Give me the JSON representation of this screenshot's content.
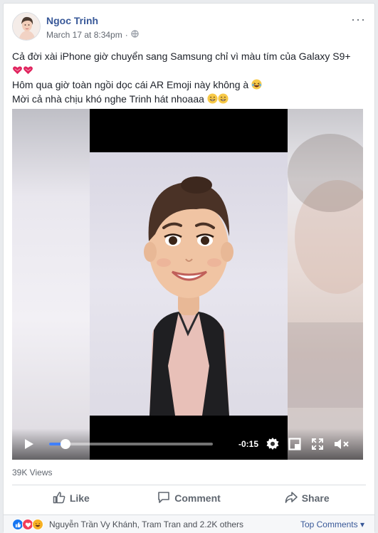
{
  "post": {
    "author": "Ngoc Trinh",
    "timestamp": "March 17 at 8:34pm",
    "separator": "·",
    "audience_icon": "globe-icon",
    "more_label": "···",
    "lines": [
      "Cả đời xài iPhone giờ chuyển sang Samsung chỉ vì màu tím của Galaxy S9+",
      "Hôm qua giờ toàn ngồi dọc cái AR Emoji này không à",
      "Mời cả nhà chịu khó nghe Trinh hát nhoaaa"
    ]
  },
  "video": {
    "remaining_time": "-0:15",
    "progress": 0.1,
    "icons": [
      "play-icon",
      "settings-gear-icon",
      "pip-icon",
      "fullscreen-icon",
      "mute-icon"
    ]
  },
  "stats": {
    "views": "39K Views"
  },
  "actions": {
    "like": "Like",
    "comment": "Comment",
    "share": "Share"
  },
  "reactions": {
    "icons": [
      "like-reaction-icon",
      "love-reaction-icon",
      "haha-reaction-icon"
    ],
    "summary": "Nguyễn Trần Vy Khánh, Tram Tran and 2.2K others",
    "sort_label": "Top Comments ▾"
  },
  "colors": {
    "link": "#385898",
    "accent": "#4080ff",
    "like_blue": "#1877f2",
    "love_red": "#f33e58",
    "haha_yellow": "#f7b125"
  }
}
